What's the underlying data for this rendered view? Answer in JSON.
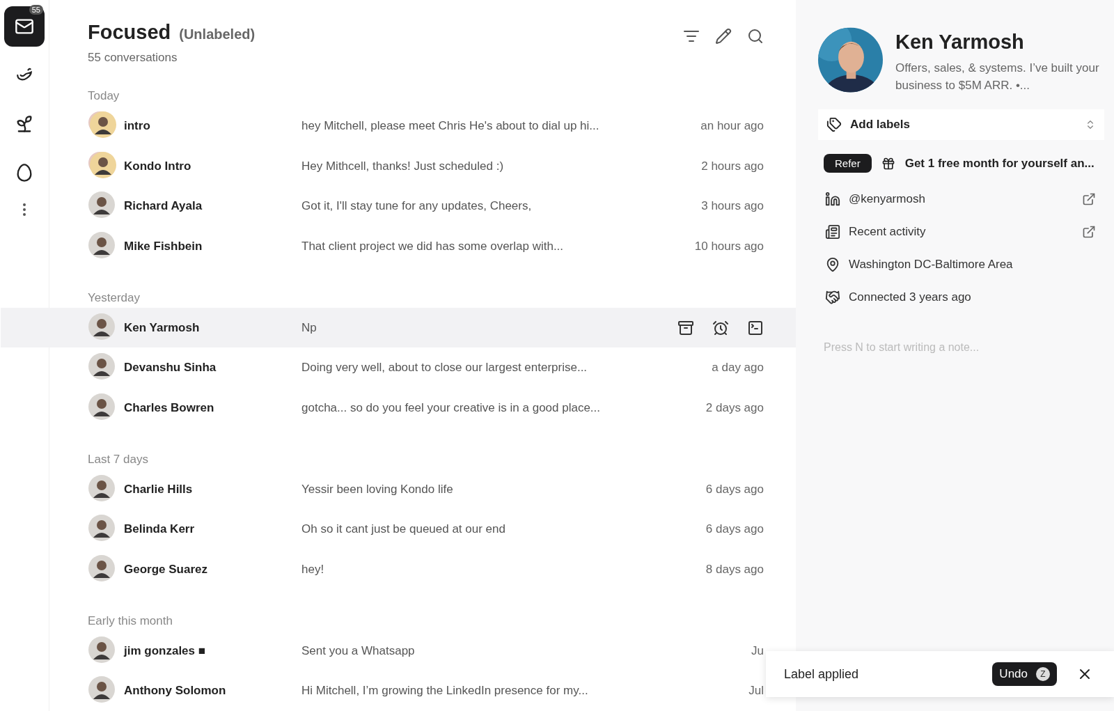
{
  "rail": {
    "badge": "55",
    "items": [
      {
        "selected": true
      },
      {
        "selected": false
      },
      {
        "selected": false
      },
      {
        "selected": false
      }
    ]
  },
  "header": {
    "title": "Focused",
    "filter": "(Unlabeled)",
    "count": "55 conversations"
  },
  "groups": [
    {
      "label": "Today",
      "rows": [
        {
          "kind": "group",
          "name": "intro",
          "preview": "hey Mitchell, please meet Chris He's about to dial up hi...",
          "time": "an hour ago",
          "selected": false
        },
        {
          "kind": "group",
          "name": "Kondo Intro",
          "preview": "Hey Mithcell, thanks! Just scheduled :)",
          "time": "2 hours ago",
          "selected": false
        },
        {
          "kind": "person",
          "name": "Richard Ayala",
          "preview": "Got it, I'll stay tune for any updates, Cheers,",
          "time": "3 hours ago",
          "selected": false
        },
        {
          "kind": "person",
          "name": "Mike Fishbein",
          "preview": "That client project we did has some overlap with...",
          "time": "10 hours ago",
          "selected": false
        }
      ]
    },
    {
      "label": "Yesterday",
      "rows": [
        {
          "kind": "person",
          "name": "Ken Yarmosh",
          "preview": "Np",
          "selected": true
        },
        {
          "kind": "person",
          "name": "Devanshu Sinha",
          "preview": "Doing very well, about to close our largest enterprise...",
          "time": "a day ago",
          "selected": false
        },
        {
          "kind": "person",
          "name": "Charles Bowren",
          "preview": "gotcha... so do you feel your creative is in a good place...",
          "time": "2 days ago",
          "selected": false
        }
      ]
    },
    {
      "label": "Last 7 days",
      "rows": [
        {
          "kind": "person",
          "name": "Charlie Hills",
          "preview": "Yessir been loving Kondo life",
          "time": "6 days ago",
          "selected": false
        },
        {
          "kind": "person",
          "name": "Belinda Kerr",
          "preview": "Oh so it cant just be queued at our end",
          "time": "6 days ago",
          "selected": false
        },
        {
          "kind": "person",
          "name": "George Suarez",
          "preview": "hey!",
          "time": "8 days ago",
          "selected": false
        }
      ]
    },
    {
      "label": "Early this month",
      "rows": [
        {
          "kind": "person",
          "name": "jim gonzales ■",
          "preview": "Sent you a Whatsapp",
          "time": "Ju",
          "selected": false
        },
        {
          "kind": "person",
          "name": "Anthony Solomon",
          "preview": "Hi Mitchell, I’m growing the LinkedIn presence for my...",
          "time": "Jul",
          "selected": false
        }
      ]
    }
  ],
  "profile": {
    "name": "Ken Yarmosh",
    "bio": "Offers, sales, & systems. I’ve built your business to $5M ARR. •...",
    "labels": "Add labels",
    "refer": {
      "badge": "Refer",
      "text": "Get 1 free month for yourself an..."
    },
    "links": [
      {
        "text": "@kenyarmosh",
        "external": true
      },
      {
        "text": "Recent activity",
        "external": true
      },
      {
        "text": "Washington DC-Baltimore Area",
        "external": false
      },
      {
        "text": "Connected 3 years ago",
        "external": false
      }
    ],
    "note": {
      "placeholder": "Press N to start writing a note..."
    }
  },
  "toast": {
    "text": "Label applied",
    "button": "Undo",
    "shortcut": "Z"
  }
}
